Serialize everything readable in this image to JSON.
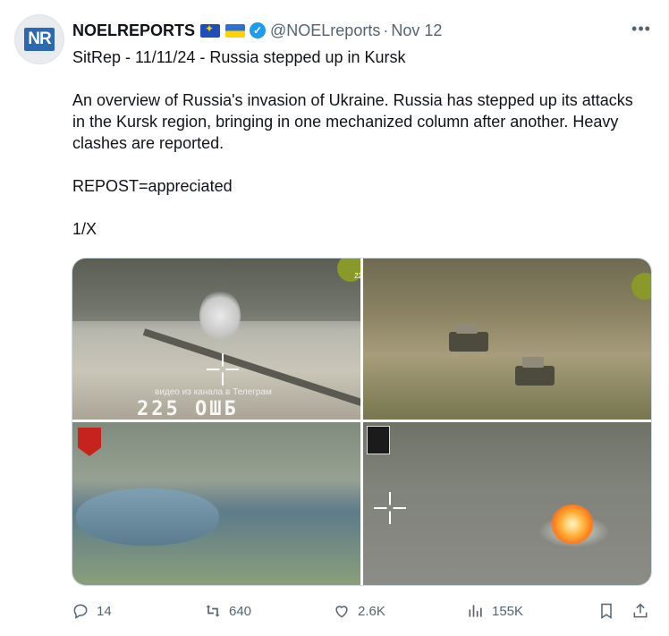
{
  "avatar": {
    "mark": "NR"
  },
  "author": {
    "name": "NOELREPORTS",
    "handle": "@NOELreports",
    "separator": "·",
    "date": "Nov 12"
  },
  "more_icon": "more-horizontal-icon",
  "tweet_text": "SitRep - 11/11/24 - Russia stepped up in Kursk\n\nAn overview of Russia's invasion of Ukraine. Russia has stepped up its attacks in the Kursk region, bringing in one mechanized column after another. Heavy clashes are reported.\n\nREPOST=appreciated\n\n1/X",
  "media": {
    "image1": {
      "watermark_caption": "видео из канала в Телеграм",
      "watermark_big": "225 ОШБ",
      "badge": "22"
    },
    "image2": {
      "badge": ""
    },
    "image3": {},
    "image4": {}
  },
  "actions": {
    "replies": "14",
    "reposts": "640",
    "likes": "2.6K",
    "views": "155K"
  },
  "colors": {
    "text": "#0f1419",
    "muted": "#536471",
    "verified": "#1d9bf0",
    "border": "#cfd9de"
  }
}
